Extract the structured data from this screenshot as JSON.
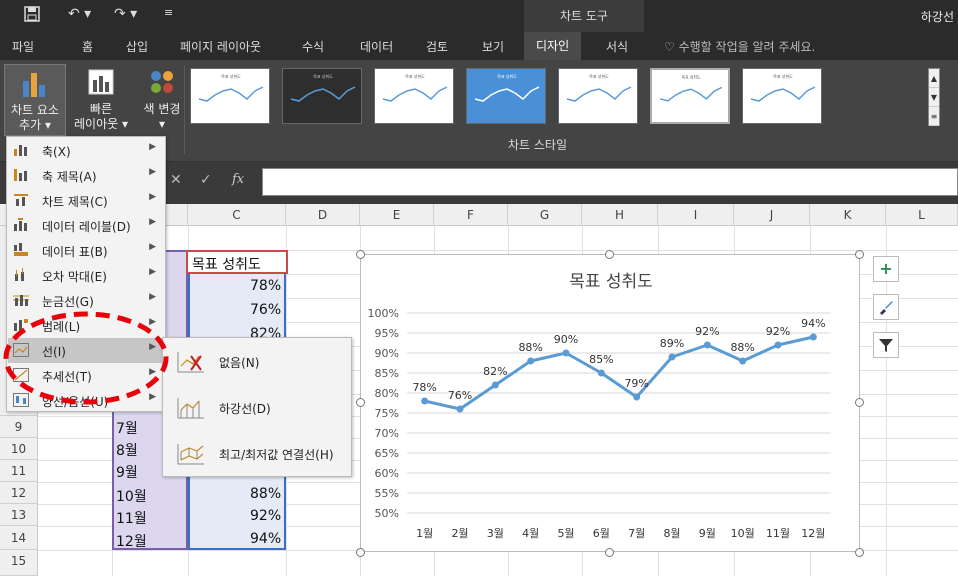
{
  "titlebar": {
    "save_icon": "save-icon",
    "undo_icon": "undo-icon",
    "redo_icon": "redo-icon",
    "customize_icon": "customize-qat-icon",
    "context_tab": "차트 도구",
    "doc_title": "하강선"
  },
  "tabs": [
    "파일",
    "홈",
    "삽입",
    "페이지 레이아웃",
    "수식",
    "데이터",
    "검토",
    "보기",
    "디자인",
    "서식"
  ],
  "active_tab": "디자인",
  "tell_me": "수행할 작업을 알려 주세요.",
  "ribbon": {
    "add_element_line1": "차트 요소",
    "add_element_line2": "추가",
    "quick_layout_line1": "빠른",
    "quick_layout_line2": "레이아웃",
    "change_colors": "색 변경",
    "group_styles": "차트 스타일",
    "style_thumb_title": "목표 성취도"
  },
  "formula_bar": {
    "fx": "fx"
  },
  "columns": [
    "C",
    "D",
    "E",
    "F",
    "G",
    "H",
    "I",
    "J",
    "K",
    "L"
  ],
  "rows": [
    "9",
    "10",
    "11",
    "12",
    "13",
    "14",
    "15"
  ],
  "table": {
    "header": "목표 성취도",
    "c_values": [
      "78%",
      "76%",
      "82%",
      "88%",
      "92%",
      "94%"
    ],
    "b_values": [
      "7월",
      "8월",
      "9월",
      "10월",
      "11월",
      "12월"
    ]
  },
  "menu": {
    "items": [
      {
        "label": "축(X)",
        "icon": "axes-icon"
      },
      {
        "label": "축 제목(A)",
        "icon": "axis-title-icon"
      },
      {
        "label": "차트 제목(C)",
        "icon": "chart-title-icon"
      },
      {
        "label": "데이터 레이블(D)",
        "icon": "data-labels-icon"
      },
      {
        "label": "데이터 표(B)",
        "icon": "data-table-icon"
      },
      {
        "label": "오차 막대(E)",
        "icon": "error-bars-icon"
      },
      {
        "label": "눈금선(G)",
        "icon": "gridlines-icon"
      },
      {
        "label": "범례(L)",
        "icon": "legend-icon"
      },
      {
        "label": "선(I)",
        "icon": "lines-icon"
      },
      {
        "label": "추세선(T)",
        "icon": "trendline-icon"
      },
      {
        "label": "양선/음선(U)",
        "icon": "updown-bars-icon"
      }
    ],
    "highlighted_index": 8
  },
  "submenu": {
    "items": [
      {
        "label": "없음(N)",
        "icon": "none-lines-icon"
      },
      {
        "label": "하강선(D)",
        "icon": "drop-lines-icon"
      },
      {
        "label": "최고/최저값 연결선(H)",
        "icon": "high-low-lines-icon"
      }
    ]
  },
  "side_buttons": {
    "elements": "+",
    "styles_icon": "brush-icon",
    "filter_icon": "filter-icon"
  },
  "colors": {
    "line": "#5b9bd5",
    "annotation": "#e8000a",
    "menu_highlight": "#c6c6c6"
  },
  "chart_data": {
    "type": "line",
    "title": "목표 성취도",
    "categories": [
      "1월",
      "2월",
      "3월",
      "4월",
      "5월",
      "6월",
      "7월",
      "8월",
      "9월",
      "10월",
      "11월",
      "12월"
    ],
    "values": [
      78,
      76,
      82,
      88,
      90,
      85,
      79,
      89,
      92,
      88,
      92,
      94
    ],
    "data_labels": [
      "78%",
      "76%",
      "82%",
      "88%",
      "90%",
      "85%",
      "79%",
      "89%",
      "92%",
      "88%",
      "92%",
      "94%"
    ],
    "y_ticks": [
      "100%",
      "95%",
      "90%",
      "85%",
      "80%",
      "75%",
      "70%",
      "65%",
      "60%",
      "55%",
      "50%"
    ],
    "ylim": [
      50,
      100
    ],
    "grid": true,
    "legend": "none"
  }
}
